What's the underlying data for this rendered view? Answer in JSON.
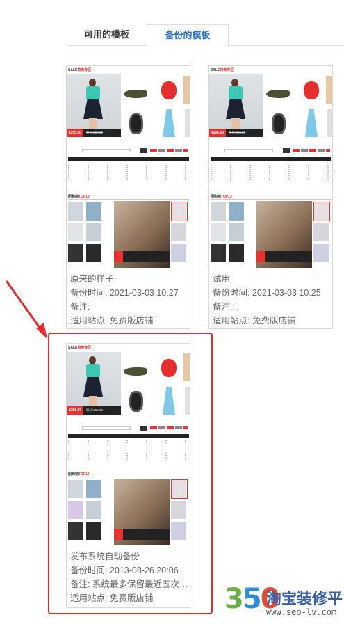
{
  "tabs": {
    "available": "可用的模板",
    "backup": "备份的模板",
    "active": "backup"
  },
  "thumbnail": {
    "logo_prefix": "SALE",
    "logo_highlight": "特卖专区",
    "price_now": "¥256.00",
    "price_old": "原价:356.00",
    "top_title_prefix": "团购榜",
    "top_title_highlight": "TOP12",
    "feature_number": "01"
  },
  "cards": [
    {
      "name": "原来的样子",
      "backup_time": "备份时间: 2021-03-03 10:27",
      "note": "备注:",
      "site": "适用站点: 免费版店铺"
    },
    {
      "name": "试用",
      "backup_time": "备份时间: 2021-03-03 10:25",
      "note": "备注: ;",
      "site": "适用站点: 免费版店铺"
    },
    {
      "name": "发布系统自动备份",
      "backup_time": "备份时间: 2013-08-26 20:06",
      "note": "备注: 系统最多保留最近五次的...",
      "site": "适用站点: 免费版店铺"
    }
  ],
  "watermark": {
    "num_1": "3",
    "num_2": "5",
    "num_3": "0",
    "title": "淘宝装修平台",
    "url": "www.seo-lv.com"
  },
  "colors": {
    "accent_blue": "#2b6fc2",
    "highlight_red": "#e52c2c",
    "border": "#d8d8d8"
  }
}
